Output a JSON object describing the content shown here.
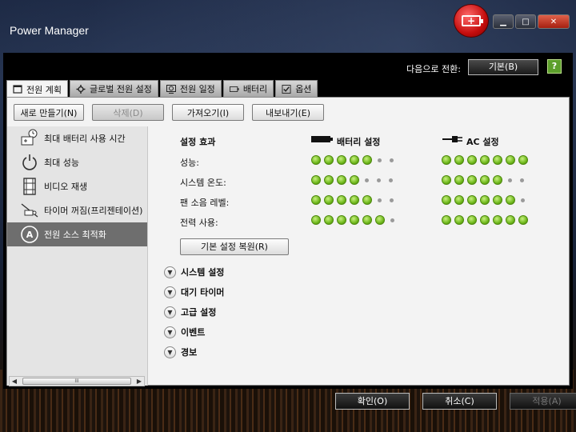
{
  "window": {
    "title": "Power Manager"
  },
  "header": {
    "switch_label": "다음으로 전환:",
    "switch_value": "기본(B)",
    "help": "?"
  },
  "tabs": [
    {
      "label": "전원 계획",
      "icon": "plan-icon"
    },
    {
      "label": "글로벌 전원 설정",
      "icon": "gear-icon"
    },
    {
      "label": "전원 일정",
      "icon": "clock-icon"
    },
    {
      "label": "배터리",
      "icon": "battery-icon"
    },
    {
      "label": "옵션",
      "icon": "checkbox-icon"
    }
  ],
  "toolbar": {
    "new": "새로 만들기(N)",
    "delete": "삭제(D)",
    "import": "가져오기(I)",
    "export": "내보내기(E)"
  },
  "sidebar": {
    "items": [
      {
        "label": "최대 배터리 사용 시간"
      },
      {
        "label": "최대 성능"
      },
      {
        "label": "비디오 재생"
      },
      {
        "label": "타이머 꺼짐(프리젠테이션)"
      },
      {
        "label": "전원 소스 최적화"
      }
    ],
    "scroll_thumb": "III"
  },
  "settings": {
    "effect_header": "설정 효과",
    "battery_header": "배터리 설정",
    "ac_header": "AC 설정",
    "rows": [
      {
        "label": "성능:",
        "battery_level": 5,
        "ac_level": 7
      },
      {
        "label": "시스템 온도:",
        "battery_level": 4,
        "ac_level": 5
      },
      {
        "label": "팬 소음 레벨:",
        "battery_level": 5,
        "ac_level": 6
      },
      {
        "label": "전력 사용:",
        "battery_level": 6,
        "ac_level": 7
      }
    ],
    "max_level": 7,
    "restore_button": "기본 설정 복원(R)"
  },
  "sections": [
    "시스템 설정",
    "대기 타이머",
    "고급 설정",
    "이벤트",
    "경보"
  ],
  "footer": {
    "ok": "확인(O)",
    "cancel": "취소(C)",
    "apply": "적용(A)"
  },
  "colors": {
    "indicator_on": "#6fb81c",
    "indicator_off": "#9a9a9a",
    "selected_item": "#6e6e6e"
  }
}
